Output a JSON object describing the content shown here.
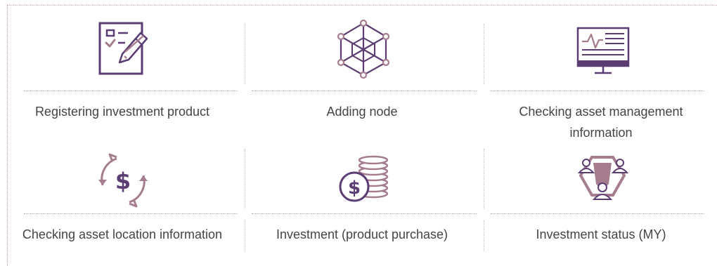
{
  "colors": {
    "accent_dark": "#5b3d74",
    "accent_mauve": "#a57d8f",
    "accent_light": "#e7d9e4",
    "text": "#444444",
    "divider": "#a8a8a8"
  },
  "items": [
    {
      "label": "Registering investment product",
      "icon": "checklist-pencil-icon"
    },
    {
      "label": "Adding node",
      "icon": "network-node-icon"
    },
    {
      "label": "Checking asset management information",
      "icon": "monitor-chart-icon"
    },
    {
      "label": "Checking asset location information",
      "icon": "dollar-cycle-icon"
    },
    {
      "label": "Investment (product purchase)",
      "icon": "coin-stack-icon"
    },
    {
      "label": "Investment status (MY)",
      "icon": "investor-network-icon"
    }
  ]
}
